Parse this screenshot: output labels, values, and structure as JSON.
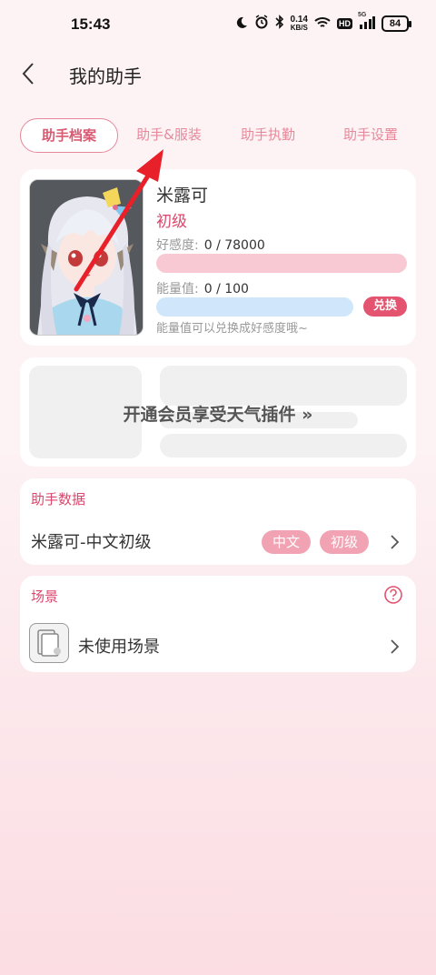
{
  "status": {
    "time": "15:43",
    "net_speed_value": "0.14",
    "net_speed_unit": "KB/S",
    "hd_label": "HD",
    "signal_label": "5G",
    "battery": "84"
  },
  "header": {
    "title": "我的助手"
  },
  "tabs": [
    {
      "label": "助手档案",
      "active": true
    },
    {
      "label": "助手&服装",
      "active": false
    },
    {
      "label": "助手执勤",
      "active": false
    },
    {
      "label": "助手设置",
      "active": false
    }
  ],
  "profile": {
    "name": "米露可",
    "level": "初级",
    "favor_label": "好感度:",
    "favor_value": "0 / 78000",
    "favor_progress": 0,
    "energy_label": "能量值:",
    "energy_value": "0 / 100",
    "energy_progress": 0,
    "exchange_button": "兑换",
    "hint": "能量值可以兑换成好感度哦~"
  },
  "weather_promo": {
    "text": "开通会员享受天气插件 »"
  },
  "assistant_data": {
    "title": "助手数据",
    "row_label": "米露可-中文初级",
    "tags": [
      "中文",
      "初级"
    ]
  },
  "scene": {
    "title": "场景",
    "row_label": "未使用场景"
  },
  "colors": {
    "accent": "#d9476c",
    "tag_bg": "#f2a3b3",
    "favor_bar": "#f8c9d3",
    "energy_bar": "#cfe6fb",
    "annotation_arrow": "#e8202a"
  }
}
